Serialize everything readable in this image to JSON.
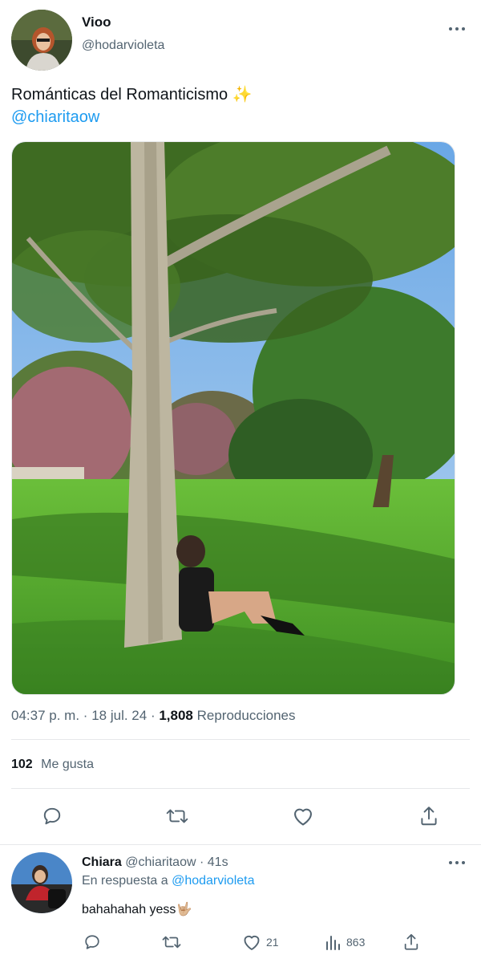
{
  "tweet": {
    "author": {
      "name": "Vioo",
      "handle": "@hodarvioleta"
    },
    "text": "Románticas del Romanticismo",
    "emoji": "✨",
    "mention": "@chiaritaow",
    "meta": {
      "time": "04:37 p. m.",
      "sep1": "·",
      "date": "18 jul. 24",
      "sep2": "·",
      "views_count": "1,808",
      "views_label": "Reproducciones"
    },
    "likes": {
      "count": "102",
      "label": "Me gusta"
    }
  },
  "actions": [
    "reply-icon",
    "retweet-icon",
    "like-icon",
    "share-icon"
  ],
  "reply": {
    "author": {
      "name": "Chiara",
      "handle": "@chiaritaow",
      "sep": "·",
      "time": "41s"
    },
    "reply_prefix": "En respuesta a",
    "reply_to": "@hodarvioleta",
    "text": "bahahahah yess",
    "emoji": "🤟🏼",
    "stats": {
      "likes": "21",
      "views": "863"
    }
  },
  "colors": {
    "accent": "#1d9bf0",
    "secondary_text": "#536471",
    "primary_text": "#0f1419"
  }
}
